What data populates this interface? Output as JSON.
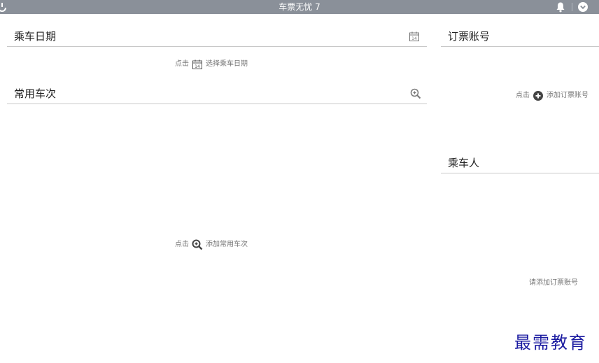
{
  "titlebar": {
    "app_title": "车票无忧 7",
    "icons": [
      "app-icon",
      "bell-icon",
      "menu-circle-icon"
    ]
  },
  "ride_date": {
    "title": "乘车日期",
    "hint_prefix": "点击",
    "hint_action": "选择乘车日期",
    "calendar_day": "14"
  },
  "frequent_trains": {
    "title": "常用车次",
    "hint_prefix": "点击",
    "hint_action": "添加常用车次"
  },
  "booking_account": {
    "title": "订票账号",
    "hint_prefix": "点击",
    "hint_action": "添加订票账号"
  },
  "passengers": {
    "title": "乘车人",
    "hint": "请添加订票账号"
  },
  "watermark": "最需教育",
  "colors": {
    "titlebar_bg": "#8a9099",
    "divider": "#c8c8c8",
    "hint_text": "#777777",
    "watermark": "#1a1aa0"
  }
}
